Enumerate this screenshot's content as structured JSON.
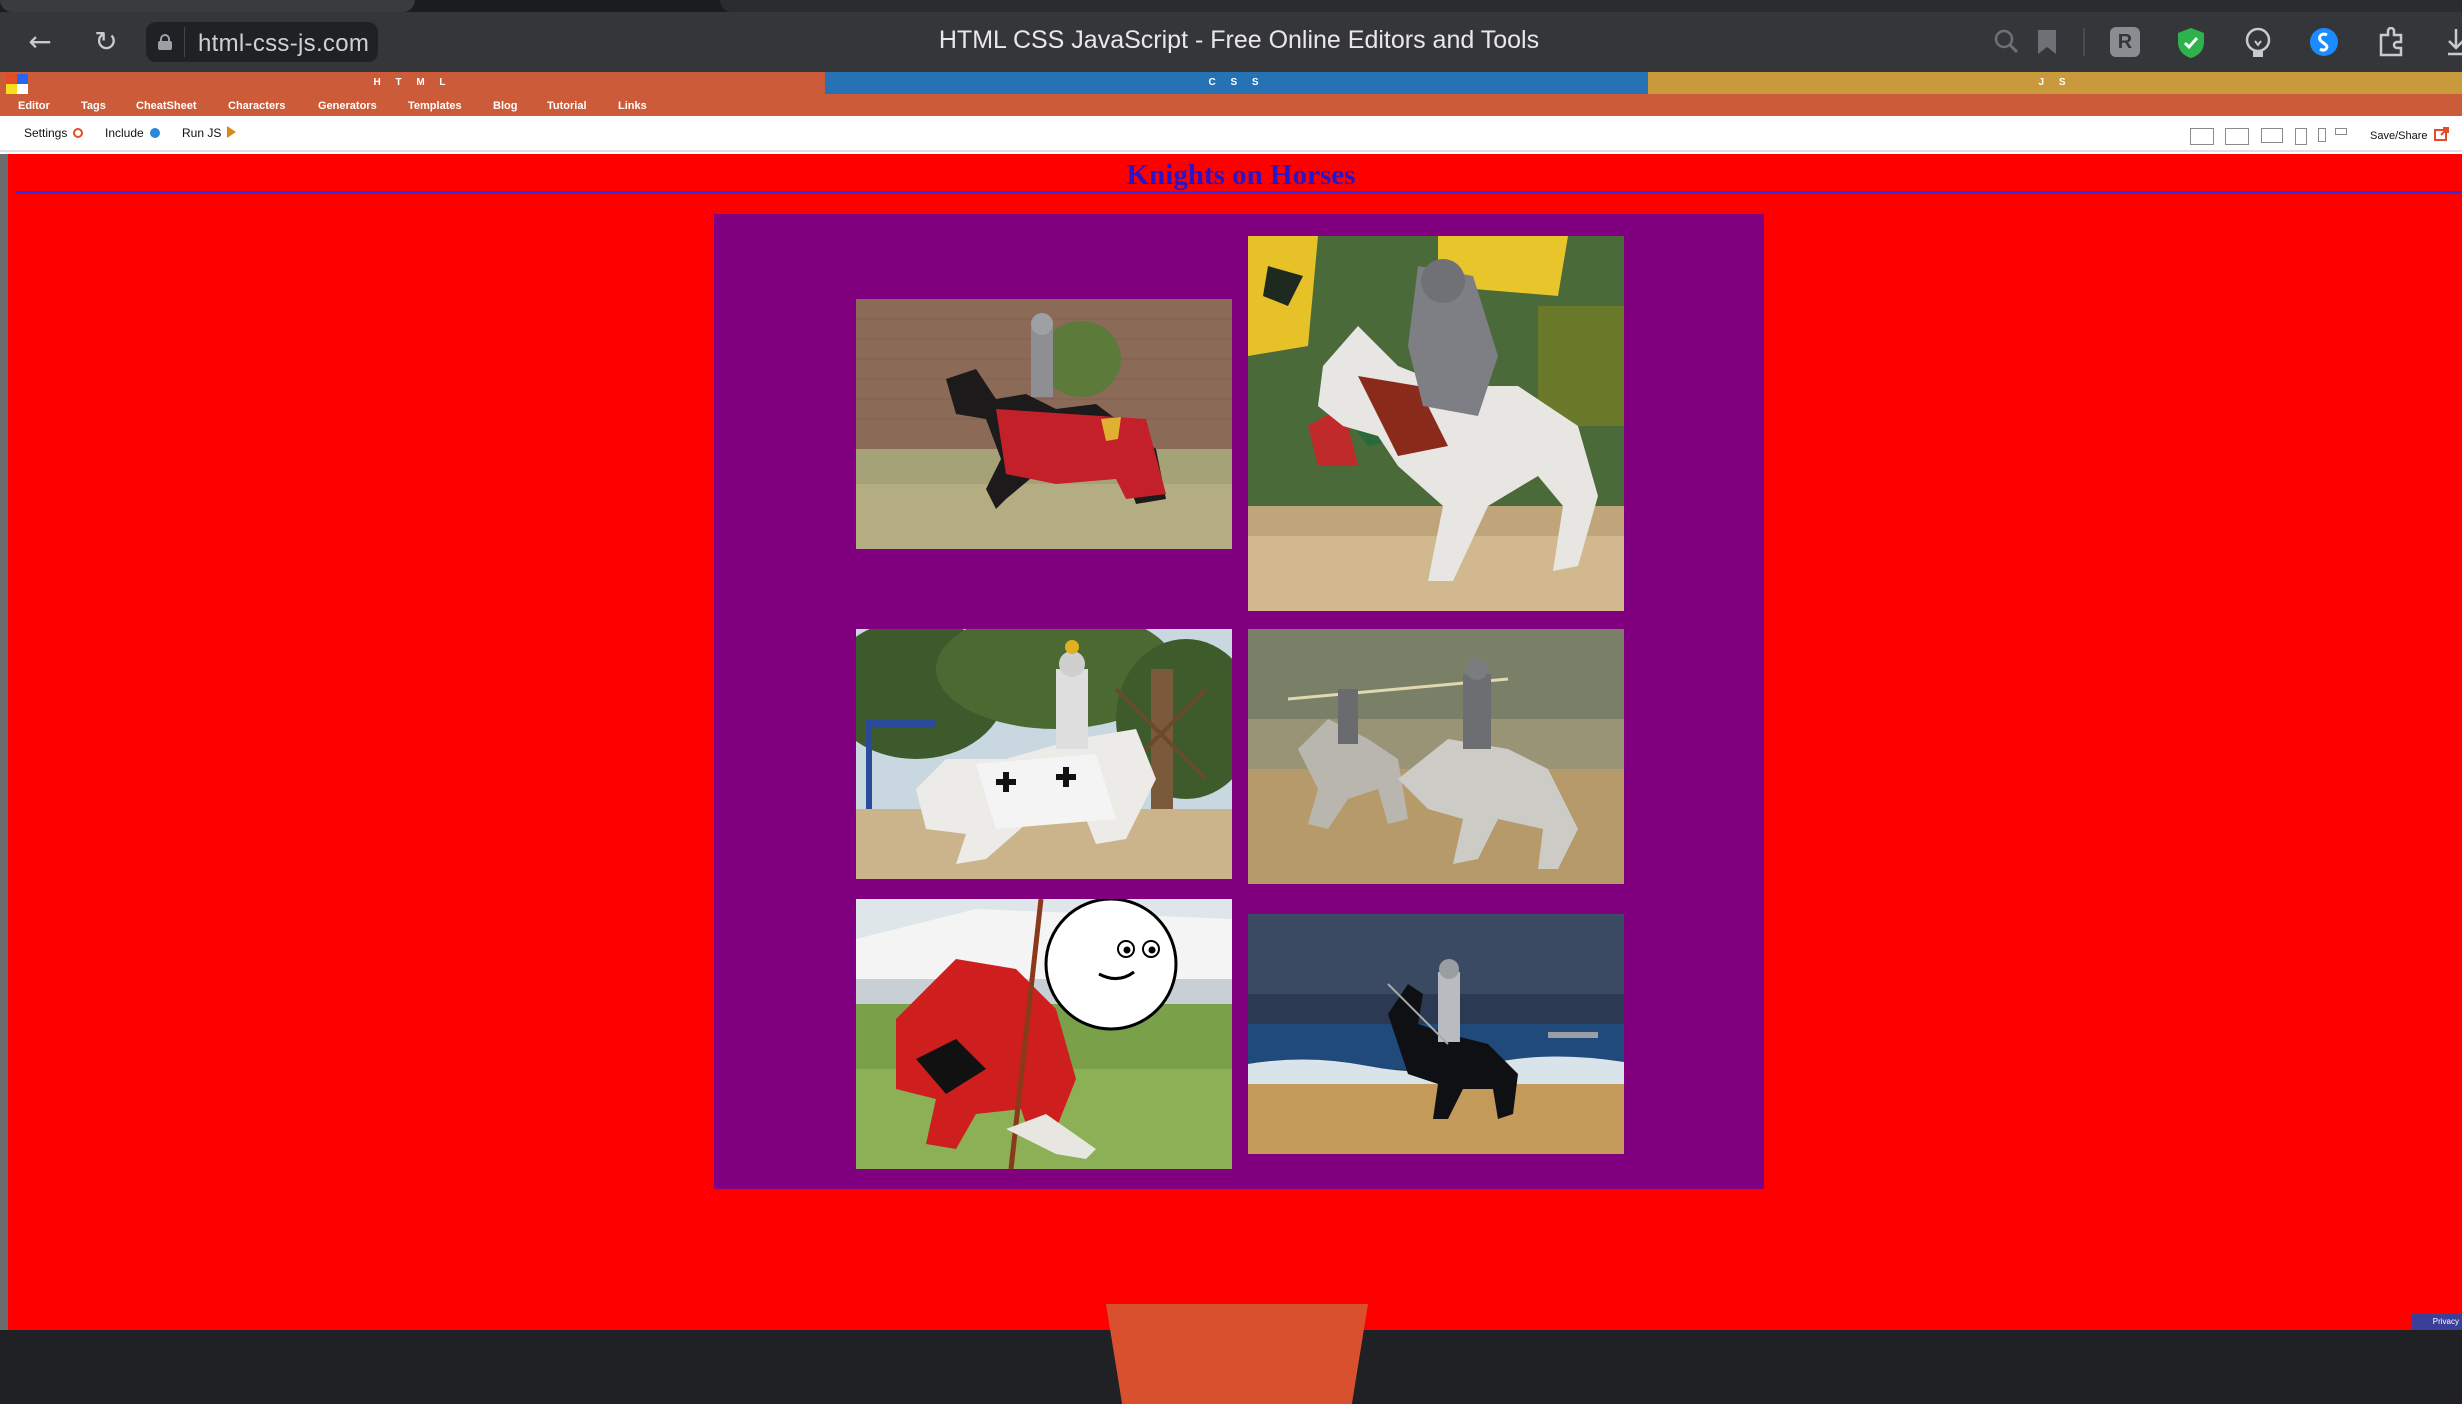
{
  "browser": {
    "url": "html-css-js.com",
    "title": "HTML CSS JavaScript - Free Online Editors and Tools",
    "extension_letter": "R"
  },
  "editor": {
    "panes": [
      "H T M L",
      "C S S",
      "J S"
    ],
    "nav": [
      "Editor",
      "Tags",
      "CheatSheet",
      "Characters",
      "Generators",
      "Templates",
      "Blog",
      "Tutorial",
      "Links"
    ],
    "settings_label": "Settings",
    "include_label": "Include",
    "run_label": "Run JS",
    "save_label": "Save/Share"
  },
  "preview": {
    "heading": "Knights on Horses",
    "privacy_label": "Privacy"
  },
  "colors": {
    "page_background": "#ff0000",
    "gallery_background": "#800080",
    "heading": "#2a14c8",
    "html_pane": "#cc5b39",
    "css_pane": "#2672b4",
    "js_pane": "#c99a3b"
  }
}
